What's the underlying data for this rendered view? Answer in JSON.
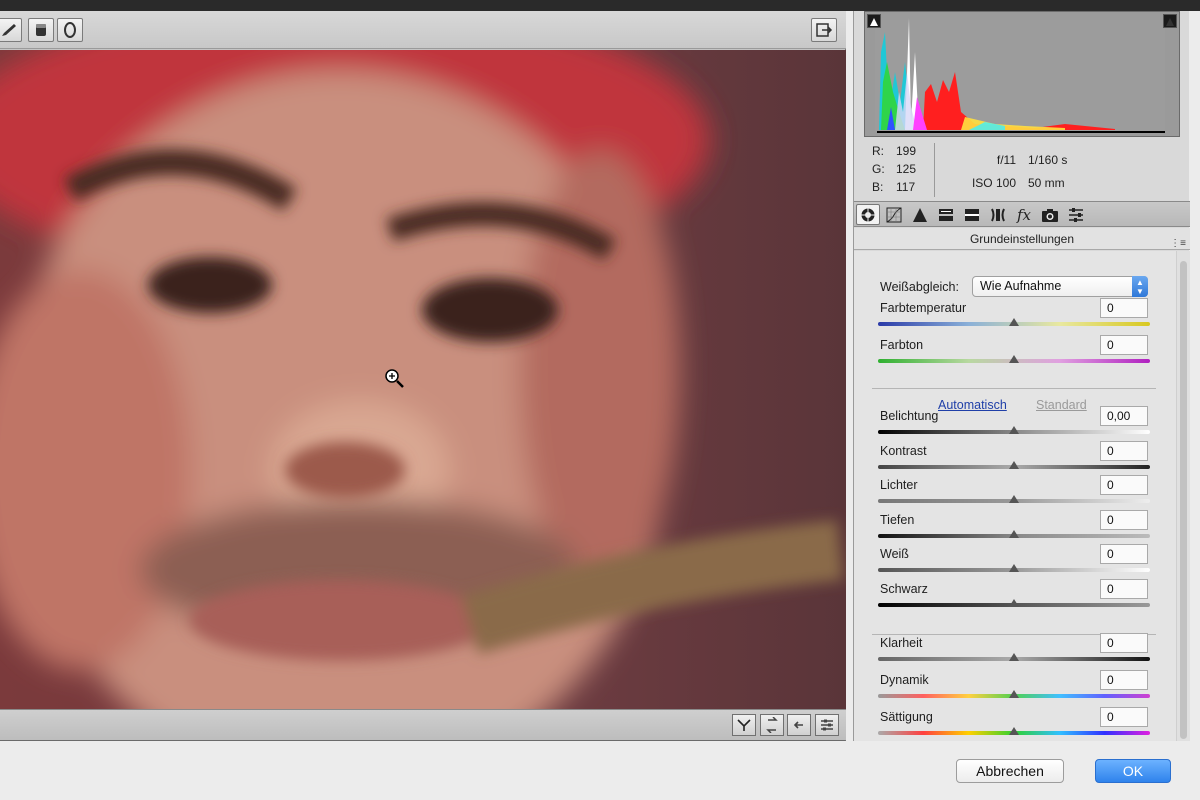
{
  "canvas": {
    "tools": [
      "brush-icon",
      "mask-square-icon",
      "mask-circle-icon"
    ],
    "fullscreen_icon": "fullscreen-toggle-icon",
    "bottom_buttons": [
      "y-before-after-icon",
      "swap-icon",
      "copy-icon",
      "settings-icon"
    ]
  },
  "readouts": {
    "r_label": "R:",
    "r": "199",
    "g_label": "G:",
    "g": "125",
    "b_label": "B:",
    "b": "117",
    "aperture": "f/11",
    "shutter": "1/160 s",
    "iso": "ISO 100",
    "focal": "50 mm"
  },
  "panel": {
    "tabs": [
      "basic-icon",
      "tone-curve-icon",
      "detail-icon",
      "hsl-icon",
      "split-toning-icon",
      "lens-icon",
      "effects-icon",
      "camera-calibration-icon",
      "presets-icon"
    ],
    "section_title": "Grundeinstellungen",
    "white_balance_label": "Weißabgleich:",
    "white_balance_value": "Wie Aufnahme",
    "auto_link": "Automatisch",
    "default_link": "Standard",
    "sliders": [
      {
        "label": "Farbtemperatur",
        "value": "0",
        "level": 0.5
      },
      {
        "label": "Farbton",
        "value": "0",
        "level": 0.5
      },
      {
        "label": "Belichtung",
        "value": "0,00",
        "level": 0.5
      },
      {
        "label": "Kontrast",
        "value": "0",
        "level": 0.5
      },
      {
        "label": "Lichter",
        "value": "0",
        "level": 0.5
      },
      {
        "label": "Tiefen",
        "value": "0",
        "level": 0.5
      },
      {
        "label": "Weiß",
        "value": "0",
        "level": 0.5
      },
      {
        "label": "Schwarz",
        "value": "0",
        "level": 0.5
      },
      {
        "label": "Klarheit",
        "value": "0",
        "level": 0.5
      },
      {
        "label": "Dynamik",
        "value": "0",
        "level": 0.5
      },
      {
        "label": "Sättigung",
        "value": "0",
        "level": 0.5
      }
    ]
  },
  "footer": {
    "cancel_label": "Abbrechen",
    "ok_label": "OK"
  },
  "colors": {
    "accent": "#2f83ec",
    "link": "#1f3fa8"
  }
}
